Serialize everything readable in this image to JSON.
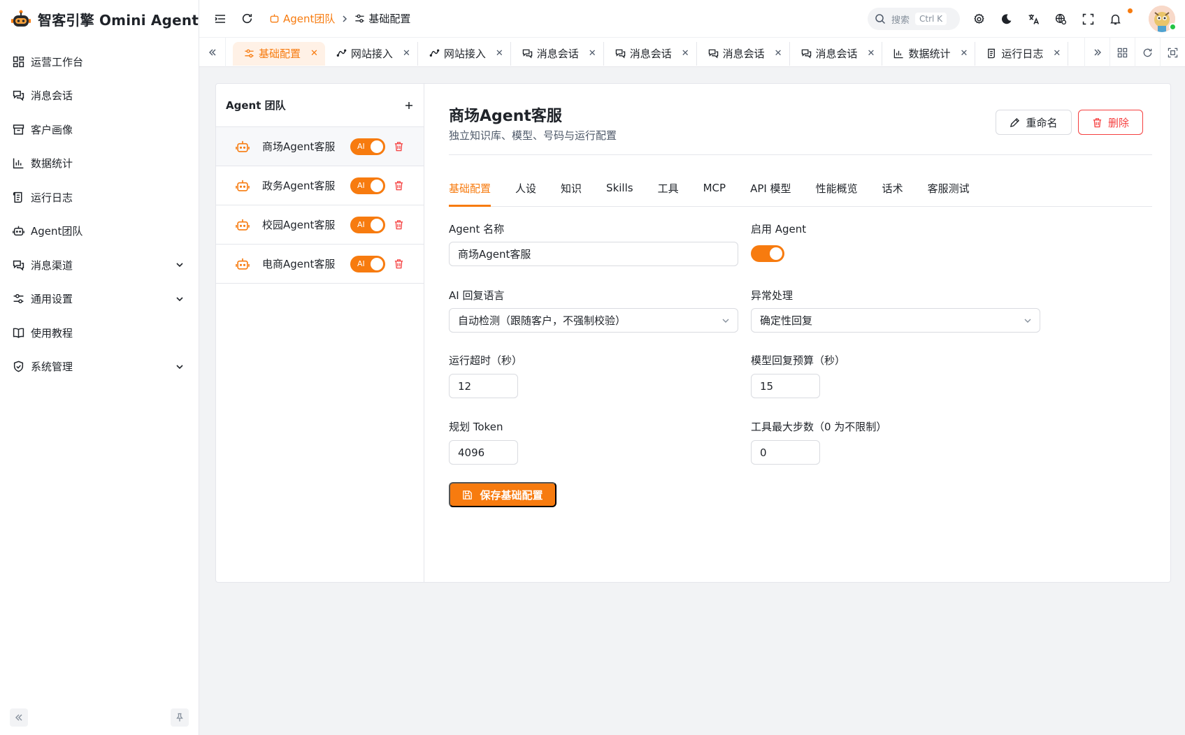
{
  "app": {
    "title": "智客引擎 Omini Agent"
  },
  "sidebar": {
    "items": [
      {
        "label": "运营工作台",
        "icon": "dashboard-icon"
      },
      {
        "label": "消息会话",
        "icon": "chat-icon"
      },
      {
        "label": "客户画像",
        "icon": "archive-icon"
      },
      {
        "label": "数据统计",
        "icon": "bar-chart-icon"
      },
      {
        "label": "运行日志",
        "icon": "log-icon"
      },
      {
        "label": "Agent团队",
        "icon": "robot-icon"
      },
      {
        "label": "消息渠道",
        "icon": "chat-icon",
        "expandable": true
      },
      {
        "label": "通用设置",
        "icon": "settings-sliders-icon",
        "expandable": true
      },
      {
        "label": "使用教程",
        "icon": "book-icon"
      },
      {
        "label": "系统管理",
        "icon": "shield-icon",
        "expandable": true
      }
    ]
  },
  "header": {
    "breadcrumb": {
      "parent": "Agent团队",
      "current": "基础配置"
    },
    "search": {
      "placeholder": "搜索",
      "shortcut": "Ctrl K"
    }
  },
  "tabs": [
    {
      "label": "基础配置",
      "active": true,
      "icon": "sliders-icon"
    },
    {
      "label": "网站接入",
      "icon": "link-icon"
    },
    {
      "label": "网站接入",
      "icon": "link-icon"
    },
    {
      "label": "消息会话",
      "icon": "chat-icon"
    },
    {
      "label": "消息会话",
      "icon": "chat-icon"
    },
    {
      "label": "消息会话",
      "icon": "chat-icon"
    },
    {
      "label": "消息会话",
      "icon": "chat-icon"
    },
    {
      "label": "数据统计",
      "icon": "bar-chart-icon"
    },
    {
      "label": "运行日志",
      "icon": "log-icon"
    }
  ],
  "agent_list": {
    "title": "Agent 团队",
    "toggle_label": "AI",
    "items": [
      {
        "name": "商场Agent客服",
        "enabled": true,
        "selected": true
      },
      {
        "name": "政务Agent客服",
        "enabled": true
      },
      {
        "name": "校园Agent客服",
        "enabled": true
      },
      {
        "name": "电商Agent客服",
        "enabled": true
      }
    ]
  },
  "detail": {
    "title": "商场Agent客服",
    "subtitle": "独立知识库、模型、号码与运行配置",
    "rename_label": "重命名",
    "delete_label": "删除",
    "tabs": [
      "基础配置",
      "人设",
      "知识",
      "Skills",
      "工具",
      "MCP",
      "API 模型",
      "性能概览",
      "话术",
      "客服测试"
    ],
    "active_tab": "基础配置",
    "form": {
      "agent_name": {
        "label": "Agent 名称",
        "value": "商场Agent客服"
      },
      "enable_agent": {
        "label": "启用 Agent",
        "value": true
      },
      "reply_language": {
        "label": "AI 回复语言",
        "value": "自动检测（跟随客户，不强制校验）"
      },
      "exception_handling": {
        "label": "异常处理",
        "value": "确定性回复"
      },
      "timeout": {
        "label": "运行超时（秒）",
        "value": "12"
      },
      "model_budget": {
        "label": "模型回复预算（秒）",
        "value": "15"
      },
      "plan_token": {
        "label": "规划 Token",
        "value": "4096"
      },
      "tool_max_steps": {
        "label": "工具最大步数（0 为不限制）",
        "value": "0"
      }
    },
    "save_label": "保存基础配置"
  },
  "colors": {
    "accent": "#f77b0f",
    "danger": "#f53f3f",
    "text": "#1f2329",
    "muted": "#4e5969"
  }
}
